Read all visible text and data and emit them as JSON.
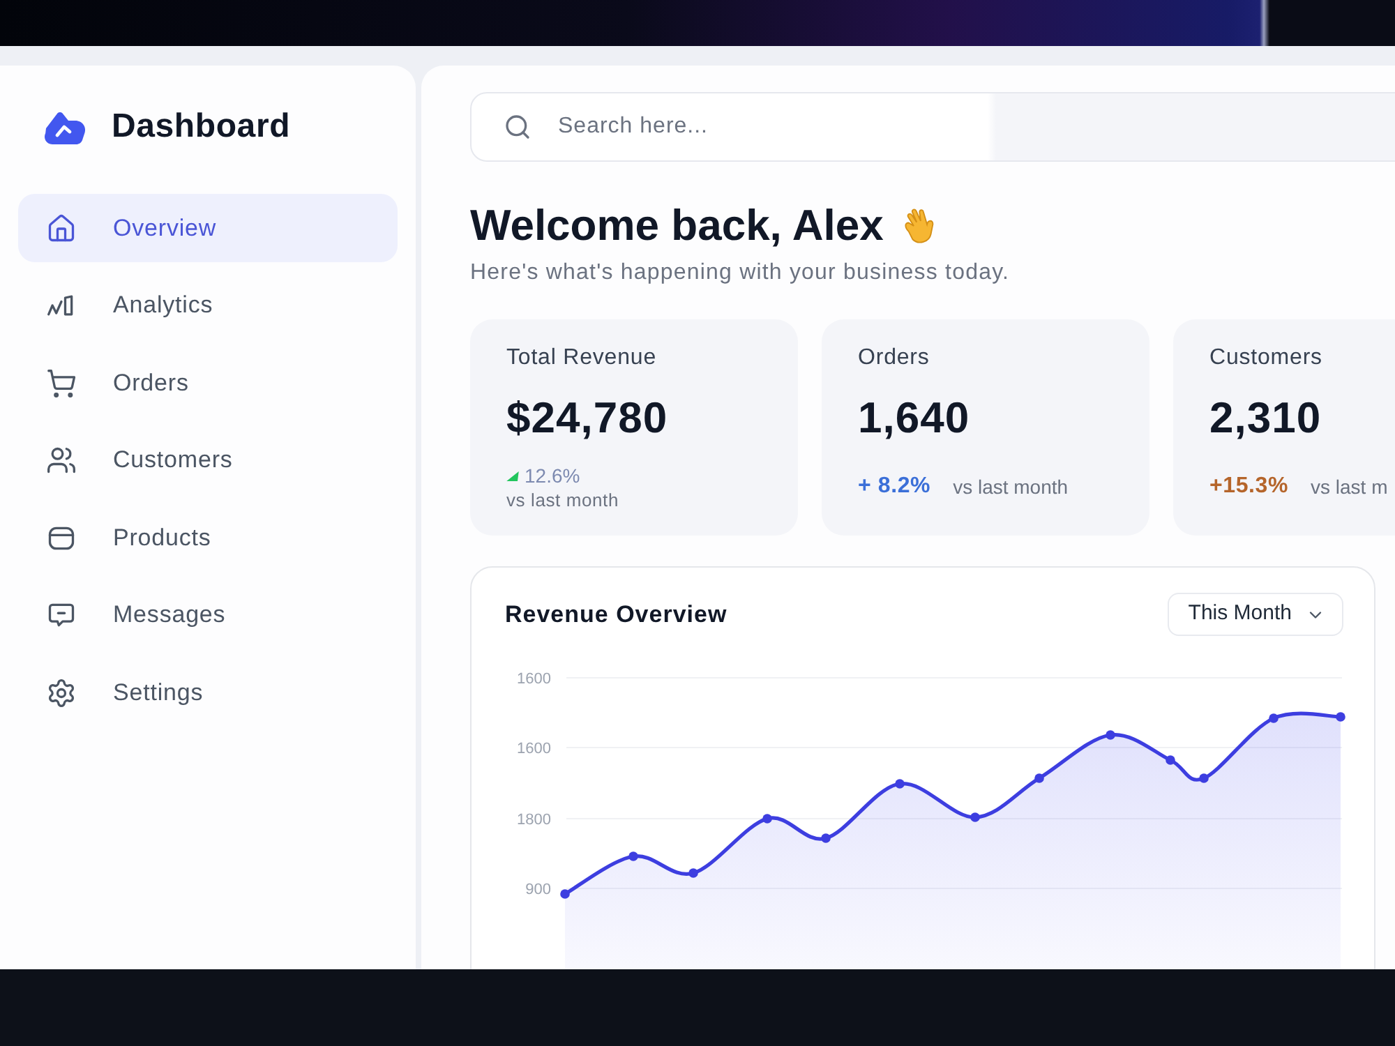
{
  "sidebar": {
    "title": "Dashboard",
    "items": [
      {
        "label": "Overview",
        "selected": true
      },
      {
        "label": "Analytics",
        "selected": false
      },
      {
        "label": "Orders",
        "selected": false
      },
      {
        "label": "Customers",
        "selected": false
      },
      {
        "label": "Products",
        "selected": false
      },
      {
        "label": "Messages",
        "selected": false
      },
      {
        "label": "Settings",
        "selected": false
      }
    ]
  },
  "search": {
    "placeholder": "Search here..."
  },
  "header": {
    "title": "Welcome back, Alex",
    "subtitle": "Here's what's happening with your business today."
  },
  "stats": [
    {
      "label": "Total Revenue",
      "value": "$24,780",
      "change": "12.6%",
      "note": "vs last month",
      "kind": "stacked",
      "color": "#22c55e"
    },
    {
      "label": "Orders",
      "value": "1,640",
      "change": "+ 8.2%",
      "note": "vs last month",
      "kind": "inline",
      "color": "#3b6fd8"
    },
    {
      "label": "Customers",
      "value": "2,310",
      "change": "+15.3%",
      "note": "vs last m",
      "kind": "inline",
      "color": "#b5652b"
    }
  ],
  "chart_panel": {
    "title": "Revenue Overview",
    "period": "This Month",
    "y_labels": [
      "1600",
      "1600",
      "1800",
      "900"
    ]
  }
}
